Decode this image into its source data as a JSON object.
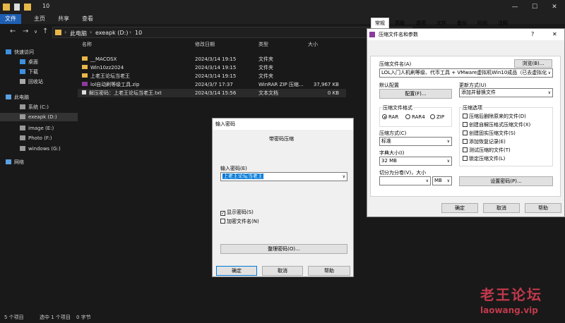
{
  "titlebar": {
    "title": "10",
    "minimize": "—",
    "maximize": "☐",
    "close": "✕"
  },
  "ribbon": {
    "file": "文件",
    "tabs": [
      "主页",
      "共享",
      "查看"
    ]
  },
  "breadcrumb": {
    "root": "此电脑",
    "drive": "exeapk (D:)",
    "folder": "10"
  },
  "sidebar": {
    "items": [
      "快速访问",
      "桌面",
      "下载",
      "回收站",
      "此电脑",
      "exeapk (D:)",
      "系统 (C:)",
      "exeapk (D:)",
      "image (E:)",
      "Photo (F:)",
      "windows (G:)",
      "网络"
    ]
  },
  "filelist": {
    "columns": [
      "名称",
      "修改日期",
      "类型",
      "大小"
    ],
    "rows": [
      {
        "name": "__MACOSX",
        "date": "2024/3/14 19:15",
        "type": "文件夹",
        "size": ""
      },
      {
        "name": "Win10zz2024",
        "date": "2024/3/14 19:15",
        "type": "文件夹",
        "size": ""
      },
      {
        "name": "上老王论坛当老王",
        "date": "2024/3/14 19:15",
        "type": "文件夹",
        "size": ""
      },
      {
        "name": "lol自动刷等级工具.zip",
        "date": "2024/3/7 17:37",
        "type": "WinRAR ZIP 压缩...",
        "size": "37,967 KB"
      },
      {
        "name": "解压密码：上老王论坛当老王.txt",
        "date": "2024/3/14 15:56",
        "type": "文本文档",
        "size": "0 KB"
      }
    ]
  },
  "status": {
    "count": "5 个项目",
    "selected": "选中 1 个项目",
    "size": "0 字节"
  },
  "password_dialog": {
    "title": "输入密码",
    "heading": "带密码压缩",
    "label": "输入密码(E)",
    "value": "上老王论坛当老王",
    "show_password": "显示密码(S)",
    "encrypt_names": "加密文件名(N)",
    "organize": "整理密码(O)...",
    "ok": "确定",
    "cancel": "取消",
    "help": "帮助"
  },
  "archive_dialog": {
    "title": "压缩文件名和参数",
    "help_q": "?",
    "close": "✕",
    "tabs": [
      "常规",
      "高级",
      "选项",
      "文件",
      "备份",
      "时间",
      "注释"
    ],
    "archive_name_label": "压缩文件名(A)",
    "browse": "浏览(B)...",
    "archive_name_value": "LOL入门人机刷等级、代币工具 + VMware虚拟机Win10成品（已去虚拟化）.rar",
    "default_profile": "默认配置",
    "profiles": "配置(F)...",
    "update_label": "更新方式(U)",
    "update_value": "添加并替换文件",
    "format_label": "压缩文件格式",
    "formats": [
      "RAR",
      "RAR4",
      "ZIP"
    ],
    "method_label": "压缩方式(C)",
    "method_value": "标准",
    "dict_label": "字典大小(I)",
    "dict_value": "32 MB",
    "split_label": "切分为分卷(V)，大小",
    "split_unit": "MB",
    "options_label": "压缩选项",
    "options": [
      "压缩后删除原来的文件(D)",
      "创建自解压格式压缩文件(X)",
      "创建固实压缩文件(S)",
      "添加恢复记录(E)",
      "测试压缩的文件(T)",
      "锁定压缩文件(L)"
    ],
    "set_password": "设置密码(P)...",
    "ok": "确定",
    "cancel": "取消",
    "help": "帮助"
  },
  "watermark": {
    "line1": "老王论坛",
    "line2": "laowang.vip"
  }
}
